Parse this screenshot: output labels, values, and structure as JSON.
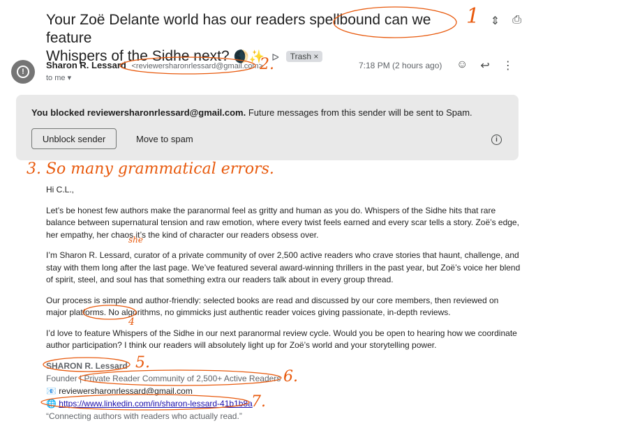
{
  "email": {
    "subject_line1": "Your Zoë Delante world has our readers spellbound can we feature",
    "subject_line2": "Whispers of the Sidhe next?",
    "subject_emoji": "🌒✨",
    "importance_marker": "ᐅ",
    "label_tag": "Trash ×",
    "sender_name": "Sharon R. Lessard",
    "sender_email": "<reviewersharonrlessard@gmail.com>",
    "recipient": "to me ▾",
    "time": "7:18 PM (2 hours ago)",
    "avatar_glyph": "!"
  },
  "banner": {
    "message_bold": "You blocked reviewersharonrlessard@gmail.com.",
    "message_rest": " Future messages from this sender will be sent to Spam.",
    "unblock_label": "Unblock sender",
    "spam_label": "Move to spam",
    "info_glyph": "i"
  },
  "body": {
    "greeting": "Hi C.L.,",
    "p1": "Let’s be honest few authors make the paranormal feel as gritty and human as you do. Whispers of the Sidhe hits that rare balance between supernatural tension and raw emotion, where every twist feels earned and every scar tells a story. Zoë’s edge, her empathy, her chaos it’s the kind of character our readers obsess over.",
    "p2": "I’m Sharon R. Lessard, curator of a private community of over 2,500 active readers who crave stories that haunt, challenge, and stay with them long after the last page. We’ve featured several award-winning thrillers in the past year, but Zoë’s voice her blend of spirit, steel, and soul has that something extra our readers talk about in every group thread.",
    "p3": "Our process is simple and author-friendly: selected books are read and discussed by our core members, then reviewed on major platforms. No algorithms, no gimmicks just authentic reader voices giving passionate, in-depth reviews.",
    "p4": "I’d love to feature Whispers of the Sidhe in our next paranormal review cycle. Would you be open to hearing how we coordinate author participation? I think our readers will absolutely light up for Zoë’s world and your storytelling power."
  },
  "signature": {
    "name": "SHARON R. Lessard",
    "title": "Founder | Private Reader Community of 2,500+ Active Readers",
    "email": "📧 reviewersharonrlessard@gmail.com",
    "link_prefix": "🌐 ",
    "link": "https://www.linkedin.com/in/sharon-lessard-41b1b8a",
    "tagline": "“Connecting authors with readers who actually read.”"
  },
  "annotations": {
    "n1": "1",
    "n2": "2.",
    "n3": "3. So many grammatical errors.",
    "n4": "4",
    "n5": "5.",
    "n6": "6.",
    "n7": "7.",
    "she": "she"
  },
  "colors": {
    "annotation": "#e8590c",
    "banner_bg": "#e9e9e9",
    "link": "#1a0dab"
  }
}
